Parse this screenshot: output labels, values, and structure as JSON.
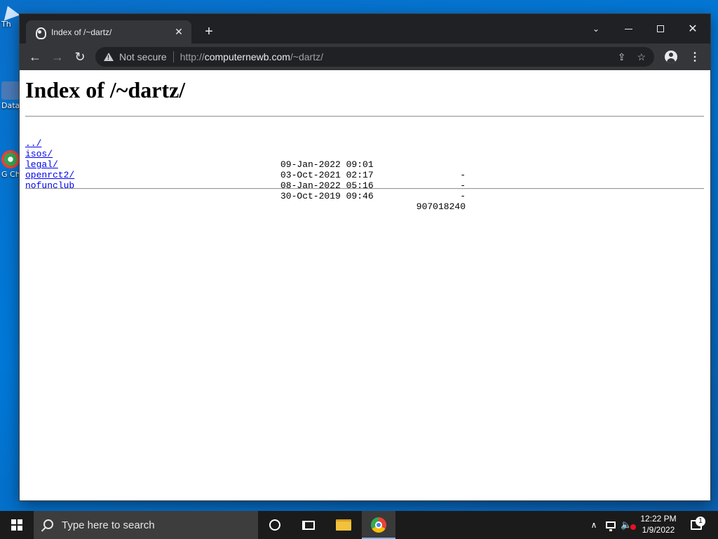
{
  "desktop": {
    "icons": [
      {
        "label": "Th",
        "icon": "recycle-bin-icon"
      },
      {
        "label": "Data",
        "icon": "shortcut-icon"
      },
      {
        "label": "G Ch",
        "icon": "chrome-shortcut-icon"
      }
    ]
  },
  "browser": {
    "tab": {
      "title": "Index of /~dartz/",
      "close": "✕"
    },
    "new_tab": "+",
    "window_controls": {
      "tab_search": "⌄",
      "close": "✕"
    },
    "nav": {
      "back": "←",
      "forward": "→",
      "reload": "↻"
    },
    "omnibox": {
      "security_label": "Not secure",
      "url_scheme": "http://",
      "url_host": "computernewb.com",
      "url_path": "/~dartz/",
      "share": "⇪",
      "bookmark": "☆"
    },
    "menu": "⋮"
  },
  "page": {
    "heading": "Index of /~dartz/",
    "entries": [
      {
        "name": "../",
        "date": "",
        "size": ""
      },
      {
        "name": "isos/",
        "date": "09-Jan-2022 09:01",
        "size": "-"
      },
      {
        "name": "legal/",
        "date": "03-Oct-2021 02:17",
        "size": "-"
      },
      {
        "name": "openrct2/",
        "date": "08-Jan-2022 05:16",
        "size": "-"
      },
      {
        "name": "nofunclub",
        "date": "30-Oct-2019 09:46",
        "size": "907018240"
      }
    ]
  },
  "taskbar": {
    "search_placeholder": "Type here to search",
    "tray_chevron": "∧",
    "volume": "🔈",
    "clock_time": "12:22 PM",
    "clock_date": "1/9/2022",
    "notification_count": "1"
  }
}
